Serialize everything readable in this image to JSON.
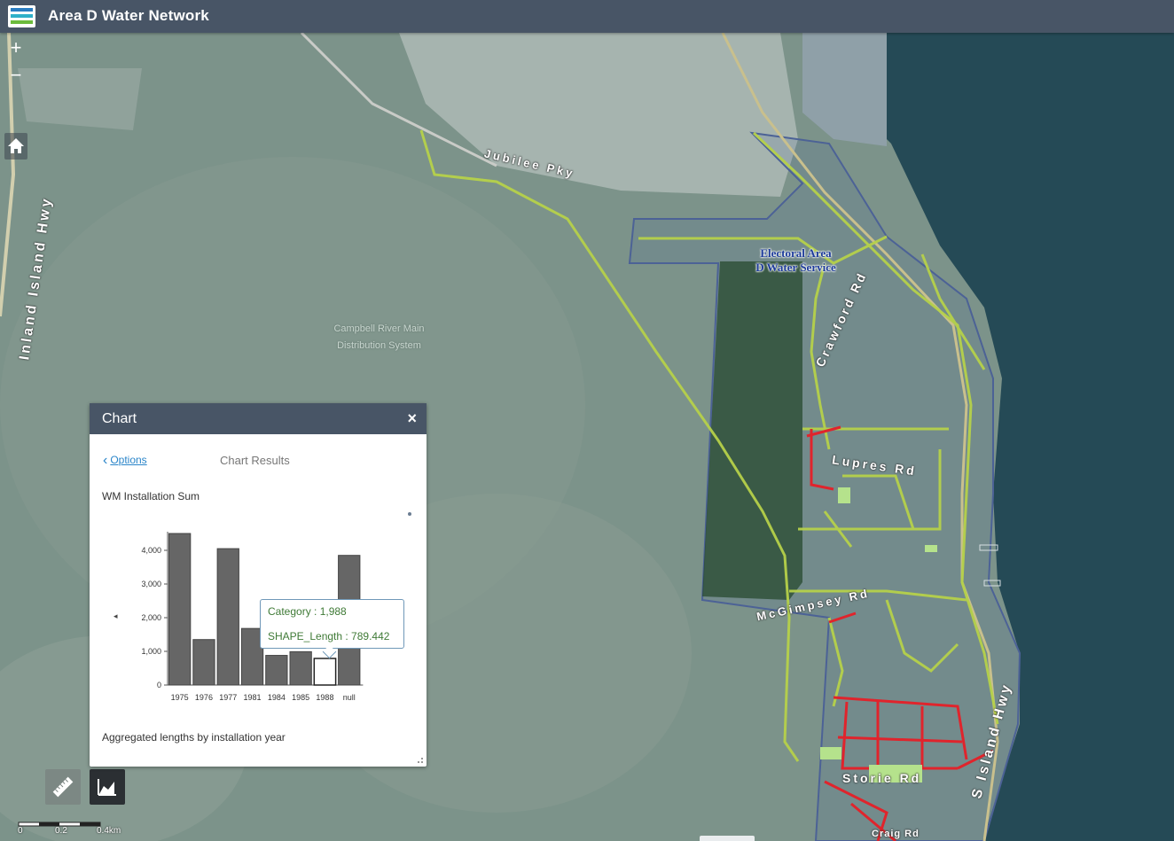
{
  "app": {
    "title": "Area D Water Network"
  },
  "map_controls": {
    "zoom_in": "+",
    "zoom_out": "−"
  },
  "map_labels": {
    "jubilee": "Jubilee Pky",
    "inland": "Inland Island Hwy",
    "crawford": "Crawford Rd",
    "lupus": "Lupres Rd",
    "mcgimpsey": "McGimpsey Rd",
    "storie": "Storie Rd",
    "craig": "Craig Rd",
    "island_hwy": "S Island Hwy",
    "campbell_1": "Campbell River Main",
    "campbell_2": "Distribution System",
    "area_d_1": "Electoral Area",
    "area_d_2": "D Water Service"
  },
  "chart_panel": {
    "title": "Chart",
    "close_glyph": "×",
    "back_label": "Options",
    "results_title": "Chart Results",
    "chart_title": "WM Installation Sum",
    "footnote": "Aggregated lengths by installation year",
    "prev_glyph": "◂",
    "tooltip": {
      "category": "Category : 1,988",
      "length": "SHAPE_Length : 789.442"
    }
  },
  "chart_data": {
    "type": "bar",
    "title": "WM Installation Sum",
    "categories": [
      "1975",
      "1976",
      "1977",
      "1981",
      "1984",
      "1985",
      "1988",
      "null"
    ],
    "values": [
      4500,
      1350,
      4050,
      1680,
      880,
      990,
      789.442,
      3850
    ],
    "ylim": [
      0,
      4500
    ],
    "yticks": [
      0,
      1000,
      2000,
      3000,
      4000
    ],
    "ytick_labels": [
      "0",
      "1,000",
      "2,000",
      "3,000",
      "4,000"
    ],
    "highlighted_category": "1988",
    "bar_color": "#666666",
    "highlight_color": "#ffffff"
  },
  "scale": {
    "zero": "0",
    "mid": "0.2",
    "end": "0.4km"
  },
  "colors": {
    "header": "#485566",
    "link": "#2a85c9",
    "mains_green": "#b6d14a",
    "mains_red": "#e0242c"
  }
}
